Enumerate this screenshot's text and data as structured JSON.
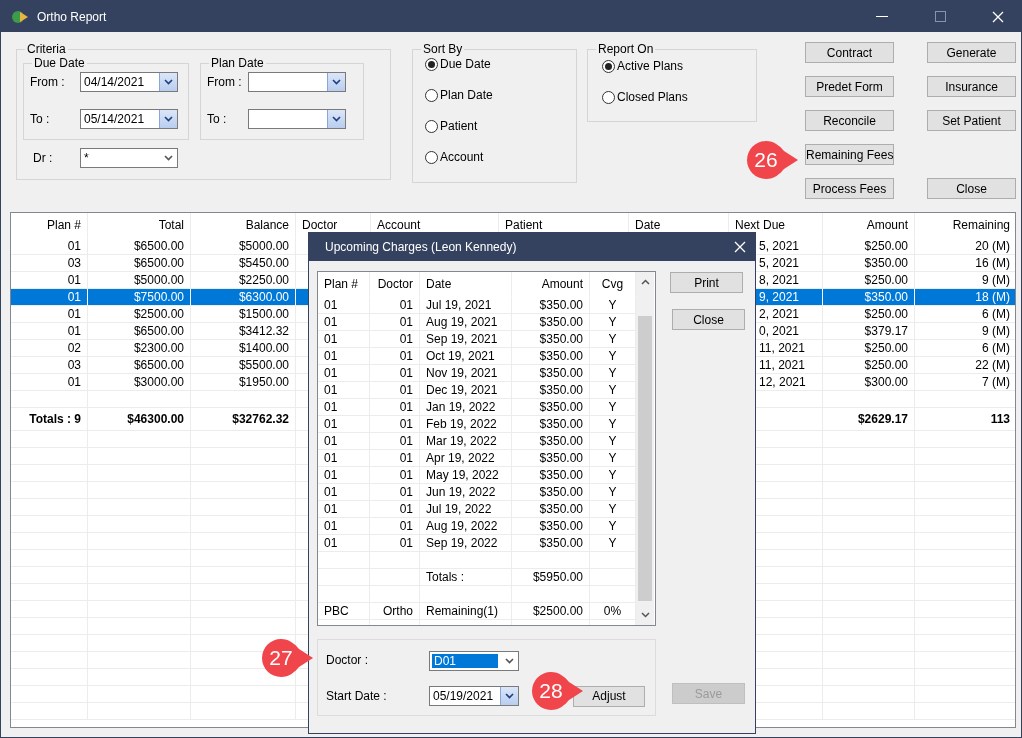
{
  "window": {
    "title": "Ortho Report"
  },
  "criteria": {
    "title": "Criteria",
    "due_date": {
      "title": "Due Date",
      "from_label": "From :",
      "from_value": "04/14/2021",
      "to_label": "To :",
      "to_value": "05/14/2021"
    },
    "plan_date": {
      "title": "Plan Date",
      "from_label": "From :",
      "to_label": "To :"
    },
    "dr_label": "Dr :",
    "dr_value": "*"
  },
  "sort_by": {
    "title": "Sort By",
    "options": [
      {
        "label": "Due Date",
        "selected": true
      },
      {
        "label": "Plan Date",
        "selected": false
      },
      {
        "label": "Patient",
        "selected": false
      },
      {
        "label": "Account",
        "selected": false
      }
    ]
  },
  "report_on": {
    "title": "Report On",
    "options": [
      {
        "label": "Active Plans",
        "selected": true
      },
      {
        "label": "Closed Plans",
        "selected": false
      }
    ]
  },
  "buttons_left": [
    "Contract",
    "Predet Form",
    "Reconcile",
    "Remaining Fees",
    "Process Fees"
  ],
  "buttons_right": [
    "Generate",
    "Insurance",
    "Set Patient",
    "Close"
  ],
  "table": {
    "columns": [
      "Plan #",
      "Total",
      "Balance",
      "Doctor",
      "Account",
      "Patient",
      "Date",
      "Next Due",
      "Amount",
      "Remaining"
    ],
    "rows": [
      {
        "plan": "01",
        "total": "$6500.00",
        "balance": "$5000.00",
        "next_due": "5, 2021",
        "amount": "$250.00",
        "remaining": "20 (M)",
        "selected": false
      },
      {
        "plan": "03",
        "total": "$6500.00",
        "balance": "$5450.00",
        "next_due": "5, 2021",
        "amount": "$350.00",
        "remaining": "16 (M)",
        "selected": false
      },
      {
        "plan": "01",
        "total": "$5000.00",
        "balance": "$2250.00",
        "next_due": "8, 2021",
        "amount": "$250.00",
        "remaining": "9 (M)",
        "selected": false
      },
      {
        "plan": "01",
        "total": "$7500.00",
        "balance": "$6300.00",
        "next_due": "9, 2021",
        "amount": "$350.00",
        "remaining": "18 (M)",
        "selected": true
      },
      {
        "plan": "01",
        "total": "$2500.00",
        "balance": "$1500.00",
        "next_due": "2, 2021",
        "amount": "$250.00",
        "remaining": "6 (M)",
        "selected": false
      },
      {
        "plan": "01",
        "total": "$6500.00",
        "balance": "$3412.32",
        "next_due": "0, 2021",
        "amount": "$379.17",
        "remaining": "9 (M)",
        "selected": false
      },
      {
        "plan": "02",
        "total": "$2300.00",
        "balance": "$1400.00",
        "next_due": "11, 2021",
        "amount": "$250.00",
        "remaining": "6 (M)",
        "selected": false
      },
      {
        "plan": "03",
        "total": "$6500.00",
        "balance": "$5500.00",
        "next_due": "11, 2021",
        "amount": "$250.00",
        "remaining": "22 (M)",
        "selected": false
      },
      {
        "plan": "01",
        "total": "$3000.00",
        "balance": "$1950.00",
        "next_due": "12, 2021",
        "amount": "$300.00",
        "remaining": "7 (M)",
        "selected": false
      }
    ],
    "totals": {
      "label": "Totals : 9",
      "total": "$46300.00",
      "balance": "$32762.32",
      "amount": "$2629.17",
      "remaining": "113"
    }
  },
  "dialog": {
    "title": "Upcoming Charges (Leon Kennedy)",
    "columns": [
      "Plan #",
      "Doctor",
      "Date",
      "Amount",
      "Cvg"
    ],
    "rows": [
      {
        "plan": "01",
        "doctor": "01",
        "date": "Jul 19, 2021",
        "amount": "$350.00",
        "cvg": "Y"
      },
      {
        "plan": "01",
        "doctor": "01",
        "date": "Aug 19, 2021",
        "amount": "$350.00",
        "cvg": "Y"
      },
      {
        "plan": "01",
        "doctor": "01",
        "date": "Sep 19, 2021",
        "amount": "$350.00",
        "cvg": "Y"
      },
      {
        "plan": "01",
        "doctor": "01",
        "date": "Oct 19, 2021",
        "amount": "$350.00",
        "cvg": "Y"
      },
      {
        "plan": "01",
        "doctor": "01",
        "date": "Nov 19, 2021",
        "amount": "$350.00",
        "cvg": "Y"
      },
      {
        "plan": "01",
        "doctor": "01",
        "date": "Dec 19, 2021",
        "amount": "$350.00",
        "cvg": "Y"
      },
      {
        "plan": "01",
        "doctor": "01",
        "date": "Jan 19, 2022",
        "amount": "$350.00",
        "cvg": "Y"
      },
      {
        "plan": "01",
        "doctor": "01",
        "date": "Feb 19, 2022",
        "amount": "$350.00",
        "cvg": "Y"
      },
      {
        "plan": "01",
        "doctor": "01",
        "date": "Mar 19, 2022",
        "amount": "$350.00",
        "cvg": "Y"
      },
      {
        "plan": "01",
        "doctor": "01",
        "date": "Apr 19, 2022",
        "amount": "$350.00",
        "cvg": "Y"
      },
      {
        "plan": "01",
        "doctor": "01",
        "date": "May 19, 2022",
        "amount": "$350.00",
        "cvg": "Y"
      },
      {
        "plan": "01",
        "doctor": "01",
        "date": "Jun 19, 2022",
        "amount": "$350.00",
        "cvg": "Y"
      },
      {
        "plan": "01",
        "doctor": "01",
        "date": "Jul 19, 2022",
        "amount": "$350.00",
        "cvg": "Y"
      },
      {
        "plan": "01",
        "doctor": "01",
        "date": "Aug 19, 2022",
        "amount": "$350.00",
        "cvg": "Y"
      },
      {
        "plan": "01",
        "doctor": "01",
        "date": "Sep 19, 2022",
        "amount": "$350.00",
        "cvg": "Y"
      }
    ],
    "totals": {
      "label": "Totals :",
      "amount": "$5950.00"
    },
    "remaining": {
      "plan": "PBC",
      "doctor": "Ortho",
      "date": "Remaining(1)",
      "amount": "$2500.00",
      "cvg": "0%"
    },
    "print_button": "Print",
    "close_button": "Close",
    "save_button": {
      "label": "Save",
      "disabled": true
    },
    "doctor_label": "Doctor :",
    "doctor_value": "D01",
    "start_date_label": "Start Date :",
    "start_date_value": "05/19/2021",
    "adjust_button": "Adjust"
  },
  "callouts": [
    {
      "number": "26"
    },
    {
      "number": "27"
    },
    {
      "number": "28"
    }
  ]
}
